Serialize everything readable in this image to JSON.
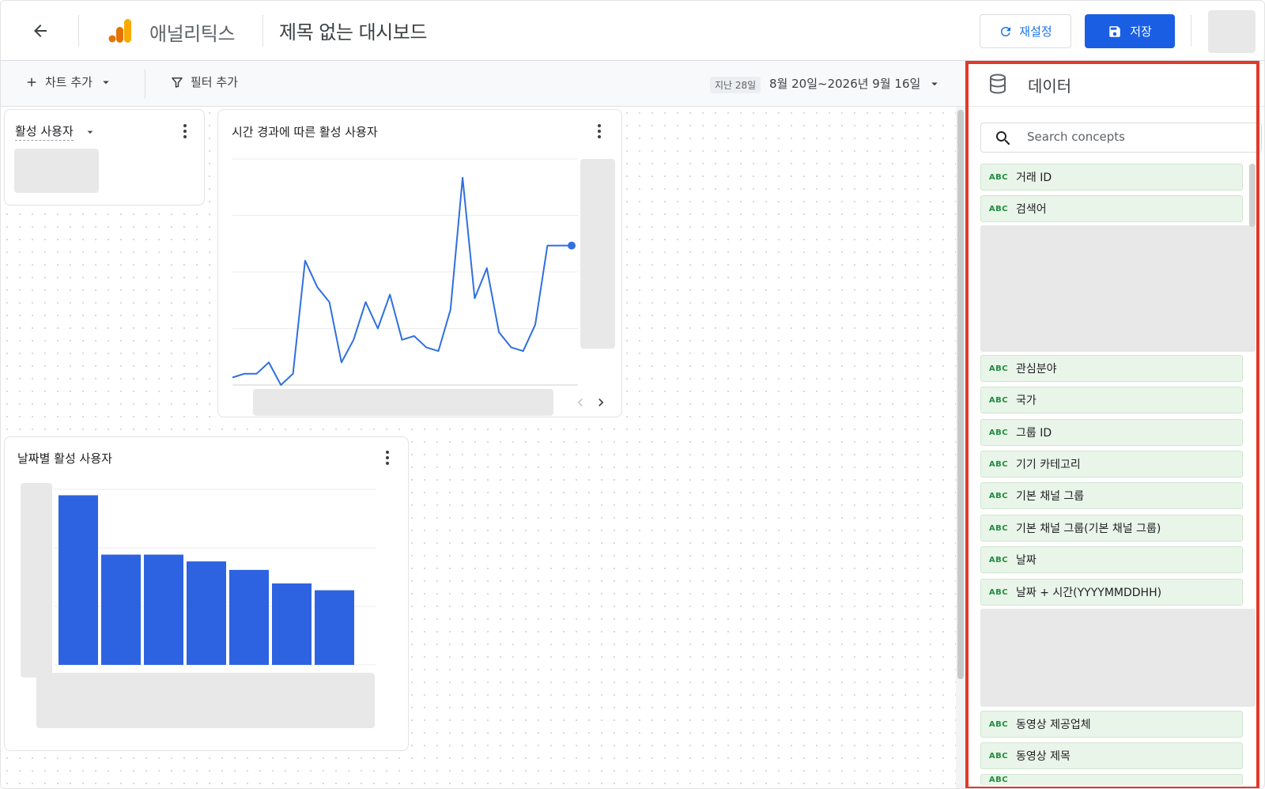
{
  "header": {
    "app_name": "애널리틱스",
    "doc_title": "제목 없는 대시보드",
    "reset_label": "재설정",
    "save_label": "저장"
  },
  "toolbar": {
    "add_chart_label": "차트 추가",
    "add_filter_label": "필터 추가",
    "date_tag": "지난 28일",
    "date_range": "8월 20일~2026년 9월 16일"
  },
  "cards": {
    "scorecard_title": "활성 사용자",
    "line_title": "시간 경과에 따른 활성 사용자",
    "bar_title": "날짜별 활성 사용자"
  },
  "chart_data": [
    {
      "type": "line",
      "title": "",
      "series": [
        {
          "values": [
            2,
            3,
            3,
            6,
            0,
            3,
            33,
            26,
            22,
            6,
            12,
            22,
            15,
            24,
            12,
            13,
            10,
            9,
            20,
            55,
            23,
            31,
            14,
            10,
            9,
            16,
            37,
            37,
            37
          ]
        }
      ],
      "ylim": [
        0,
        60
      ],
      "grid": true
    },
    {
      "type": "bar",
      "title": "",
      "values": [
        100,
        65,
        65,
        61,
        56,
        48,
        44
      ],
      "ylim": [
        0,
        110
      ],
      "grid": true
    }
  ],
  "data_panel": {
    "title": "데이터",
    "search_placeholder": "Search concepts",
    "type_badge": "ABC",
    "fields": [
      "거래 ID",
      "검색어",
      "관심분야",
      "국가",
      "그룹 ID",
      "기기 카테고리",
      "기본 채널 그룹",
      "기본 채널 그룹(기본 채널 그룹)",
      "날짜",
      "날짜 + 시간(YYYYMMDDHH)",
      "동영상 제공업체",
      "동영상 제목"
    ]
  },
  "colors": {
    "primary": "#1a5fe3",
    "line": "#2f6fe0",
    "bar": "#2d63e0",
    "highlight": "#e2392a",
    "field_bg": "#e9f5e9",
    "badge": "#1e8e3e"
  }
}
